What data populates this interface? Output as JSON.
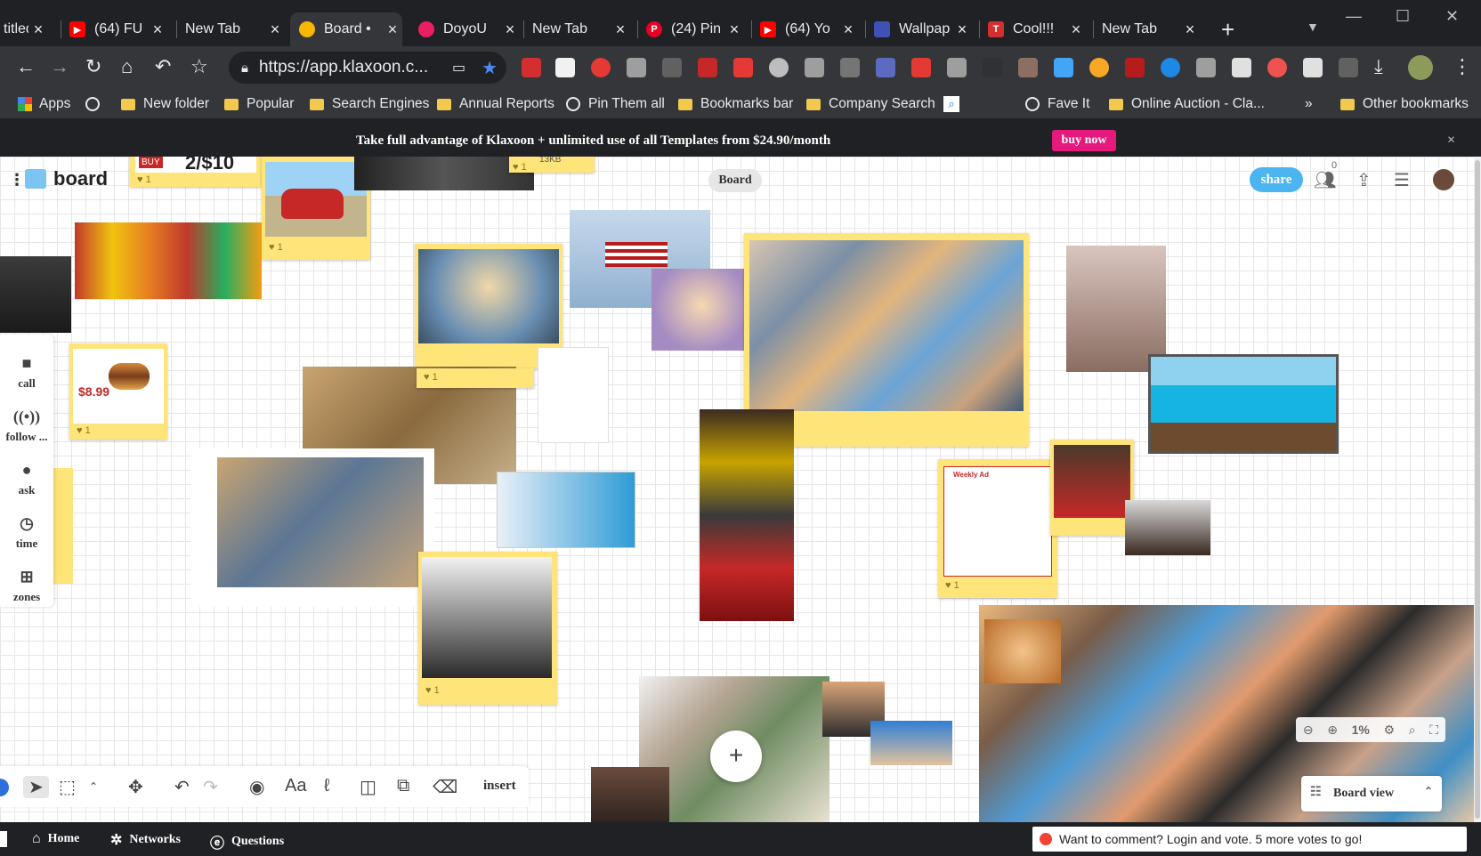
{
  "browser": {
    "tabs": [
      {
        "title": "titled",
        "favicon": "page-icon",
        "color": "#5f6368"
      },
      {
        "title": "(64) FU",
        "favicon": "youtube-icon",
        "color": "#ff0000"
      },
      {
        "title": "New Tab",
        "favicon": "",
        "color": ""
      },
      {
        "title": "Board •",
        "favicon": "klaxoon-icon",
        "color": "#f5b700"
      },
      {
        "title": "DoyoU",
        "favicon": "doyou-icon",
        "color": "#e91e63"
      },
      {
        "title": "New Tab",
        "favicon": "",
        "color": ""
      },
      {
        "title": "(24) Pin",
        "favicon": "pinterest-icon",
        "color": "#e60023"
      },
      {
        "title": "(64) Yo",
        "favicon": "youtube-icon",
        "color": "#ff0000"
      },
      {
        "title": "Wallpap",
        "favicon": "wallpaper-icon",
        "color": "#3f51b5"
      },
      {
        "title": "Cool!!!",
        "favicon": "tumblr-icon",
        "color": "#d32f2f"
      },
      {
        "title": "New Tab",
        "favicon": "",
        "color": ""
      }
    ],
    "url": "https://app.klaxoon.c...",
    "bookmarks": [
      {
        "label": "Apps",
        "type": "apps"
      },
      {
        "label": "",
        "type": "globe"
      },
      {
        "label": "New folder",
        "type": "folder"
      },
      {
        "label": "Popular",
        "type": "folder"
      },
      {
        "label": "Search Engines",
        "type": "folder"
      },
      {
        "label": "Annual Reports",
        "type": "folder"
      },
      {
        "label": "Pin Them all",
        "type": "globe"
      },
      {
        "label": "Bookmarks bar",
        "type": "folder"
      },
      {
        "label": "Company Search",
        "type": "folder"
      },
      {
        "label": "",
        "type": "search"
      },
      {
        "label": "Fave It",
        "type": "globe"
      },
      {
        "label": "Online Auction - Cla...",
        "type": "folder"
      },
      {
        "label": "»",
        "type": "more"
      },
      {
        "label": "Other bookmarks",
        "type": "folder"
      }
    ]
  },
  "banner": {
    "text": "Take full advantage of Klaxoon + unlimited use of all Templates from $24.90/month",
    "cta": "buy now",
    "close": "×"
  },
  "board": {
    "title": "board",
    "view_pill": "Board",
    "share": "share",
    "participants": "0",
    "left_tools": [
      "call",
      "follow ...",
      "ask",
      "time",
      "zones"
    ],
    "insert": "insert",
    "zoom": "1%",
    "board_view": "Board view",
    "card_text": {
      "price_banner": "2/$10",
      "buy_badge": "BUY",
      "size_note": "13KB",
      "price_tag": "$8.99",
      "weekly_ad": "Weekly Ad"
    },
    "likes": [
      "1",
      "1",
      "1",
      "1",
      "1",
      "1",
      "1",
      "1"
    ]
  },
  "bottom": {
    "home": "Home",
    "networks": "Networks",
    "questions": "Questions",
    "comment": "Want to comment? Login and vote. 5 more votes to go!"
  }
}
